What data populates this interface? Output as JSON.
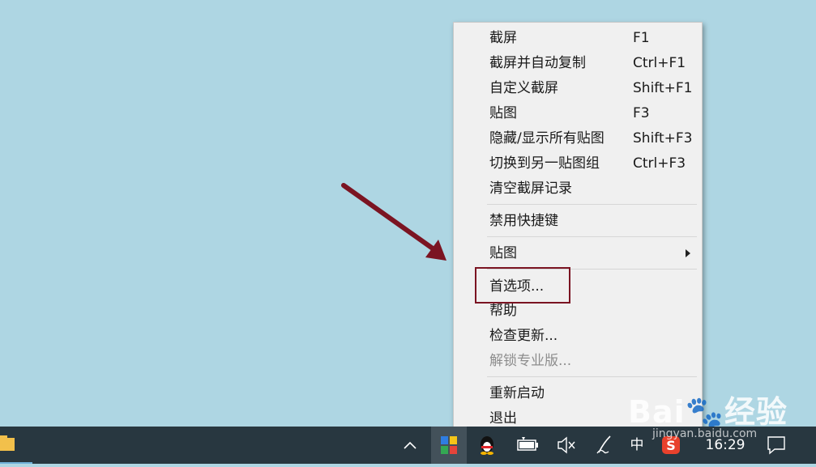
{
  "menu": {
    "items": [
      {
        "label": "截屏",
        "shortcut": "F1"
      },
      {
        "label": "截屏并自动复制",
        "shortcut": "Ctrl+F1"
      },
      {
        "label": "自定义截屏",
        "shortcut": "Shift+F1"
      },
      {
        "label": "贴图",
        "shortcut": "F3"
      },
      {
        "label": "隐藏/显示所有贴图",
        "shortcut": "Shift+F3"
      },
      {
        "label": "切换到另一贴图组",
        "shortcut": "Ctrl+F3"
      },
      {
        "label": "清空截屏记录"
      },
      {
        "label": "禁用快捷键"
      },
      {
        "label": "贴图",
        "submenu": true
      },
      {
        "label": "首选项..."
      },
      {
        "label": "帮助"
      },
      {
        "label": "检查更新..."
      },
      {
        "label": "解锁专业版...",
        "disabled": true
      },
      {
        "label": "重新启动"
      },
      {
        "label": "退出"
      }
    ]
  },
  "annotation": {
    "arrow_color": "#7b1422",
    "box_color": "#7b1422"
  },
  "taskbar": {
    "ime": "中",
    "clock": "16:29",
    "background": "#283740"
  },
  "icons": {
    "explorer": "file-explorer-icon",
    "tray_expand": "chevron-up-icon",
    "snipaste": "snipaste-icon",
    "qq": "qq-penguin-icon",
    "battery": "battery-icon",
    "volume": "volume-muted-icon",
    "pen": "pen-icon",
    "sogou": "sogou-s-icon",
    "notification": "action-center-icon"
  },
  "watermark": {
    "brand": "Bai",
    "brand_suffix": "经验",
    "url": "jingyan.baidu.com"
  }
}
